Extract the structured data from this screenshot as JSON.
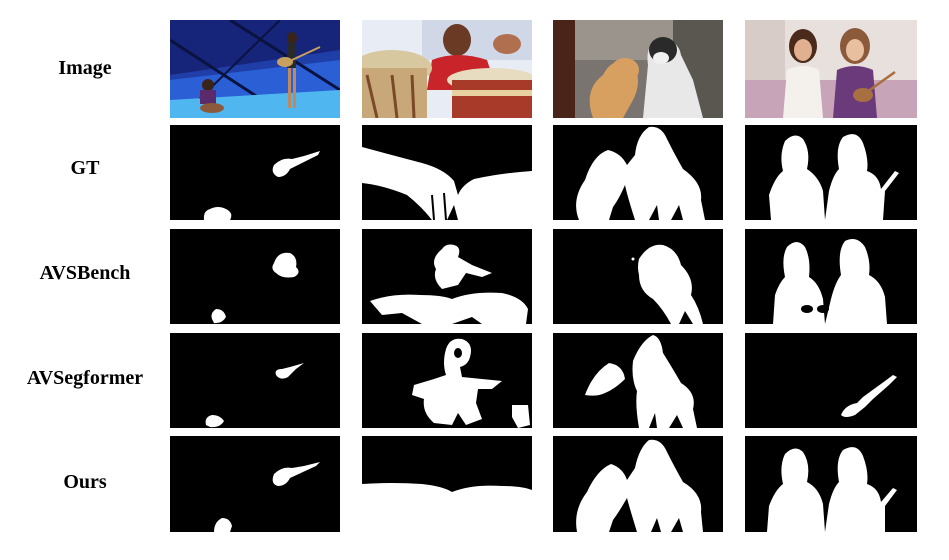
{
  "row_labels": [
    "Image",
    "GT",
    "AVSBench",
    "AVSegformer",
    "Ours"
  ],
  "colors": {
    "mask_foreground": "#ffffff",
    "mask_background": "#000000",
    "page_background": "#ffffff"
  }
}
